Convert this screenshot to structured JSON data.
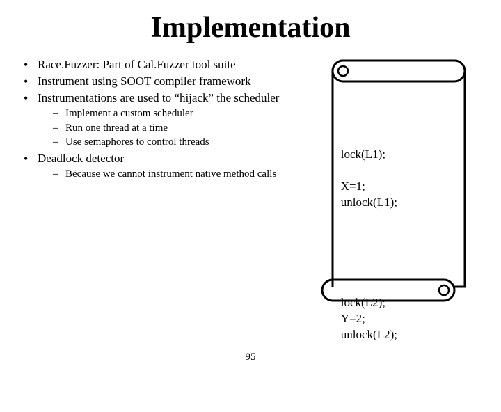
{
  "title": "Implementation",
  "bullets": {
    "b1": "Race.Fuzzer: Part of Cal.Fuzzer tool suite",
    "b2": "Instrument using SOOT compiler framework",
    "b3": "Instrumentations are used to “hijack” the scheduler",
    "b3_sub": {
      "s1": "Implement a custom scheduler",
      "s2": "Run one thread at a time",
      "s3": "Use semaphores to control threads"
    },
    "b4": "Deadlock detector",
    "b4_sub": {
      "s1": "Because we cannot instrument native method calls"
    }
  },
  "code": {
    "l1": "lock(L1);",
    "l2": "X=1;",
    "l3": "unlock(L1);",
    "l4": "lock(L2);",
    "l5": "Y=2;",
    "l6": "unlock(L2);"
  },
  "page_number": "95"
}
